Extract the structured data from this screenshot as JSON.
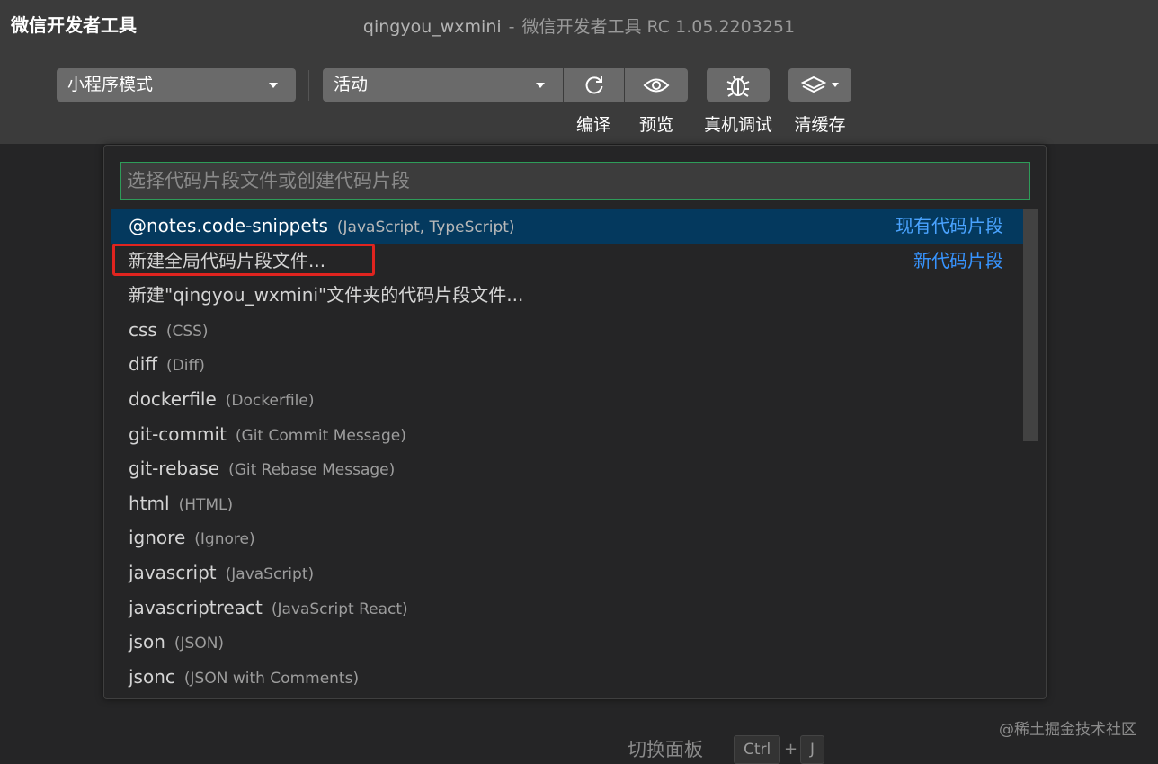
{
  "app": {
    "name": "微信开发者工具",
    "project": "qingyou_wxmini",
    "separator": "-",
    "version_title": "微信开发者工具 RC 1.05.2203251"
  },
  "toolbar": {
    "mode_select": "小程序模式",
    "compile_select": "活动",
    "compile_label": "编译",
    "preview_label": "预览",
    "debug_label": "真机调试",
    "cache_label": "清缓存"
  },
  "quickpick": {
    "placeholder": "选择代码片段文件或创建代码片段",
    "items": [
      {
        "label": "@notes.code-snippets",
        "desc": "(JavaScript, TypeScript)",
        "right": "现有代码片段"
      },
      {
        "label": "新建全局代码片段文件...",
        "desc": "",
        "right": "新代码片段"
      },
      {
        "label": "新建\"qingyou_wxmini\"文件夹的代码片段文件...",
        "desc": "",
        "right": ""
      },
      {
        "label": "css",
        "desc": "(CSS)",
        "right": ""
      },
      {
        "label": "diff",
        "desc": "(Diff)",
        "right": ""
      },
      {
        "label": "dockerfile",
        "desc": "(Dockerfile)",
        "right": ""
      },
      {
        "label": "git-commit",
        "desc": "(Git Commit Message)",
        "right": ""
      },
      {
        "label": "git-rebase",
        "desc": "(Git Rebase Message)",
        "right": ""
      },
      {
        "label": "html",
        "desc": "(HTML)",
        "right": ""
      },
      {
        "label": "ignore",
        "desc": "(Ignore)",
        "right": ""
      },
      {
        "label": "javascript",
        "desc": "(JavaScript)",
        "right": ""
      },
      {
        "label": "javascriptreact",
        "desc": "(JavaScript React)",
        "right": ""
      },
      {
        "label": "json",
        "desc": "(JSON)",
        "right": ""
      },
      {
        "label": "jsonc",
        "desc": "(JSON with Comments)",
        "right": ""
      }
    ]
  },
  "background": {
    "hint_label": "切换面板",
    "key1": "Ctrl",
    "plus": "+",
    "key2": "J"
  },
  "watermark": "@稀土掘金技术社区",
  "colors": {
    "selection": "#04395e",
    "accent_link": "#3794ff",
    "input_border": "#2e9c59",
    "highlight_box": "#e0241f"
  }
}
